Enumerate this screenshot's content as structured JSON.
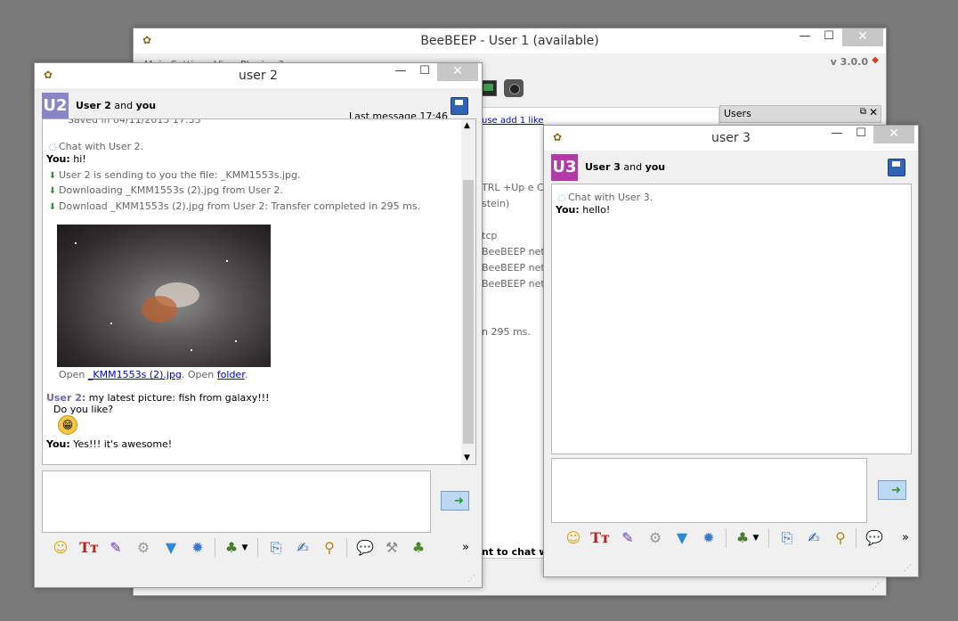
{
  "main_window": {
    "title": "BeeBEEP - User 1 (available)",
    "menu_partial": "Main Settings View Plugins ?",
    "version": "v 3.0.0",
    "users_panel_title": "Users",
    "bg_lines": [
      "TRL +Up e CTF",
      "stein)",
      "tcp",
      "BeeBEEP netv",
      "BeeBEEP netv",
      "BeeBEEP netv",
      "n 295 ms.",
      "nt to chat wi"
    ],
    "bg_link": "use add 1 like"
  },
  "chat_user2": {
    "title": "user 2",
    "badge": "U2",
    "header_user": "User 2",
    "header_and": " and ",
    "header_you": "you",
    "last_message": "Last message 17:46",
    "saved_line": "Saved in 04/11/2015 17:33",
    "messages": {
      "sys_chat": "Chat with User 2.",
      "you_label": "You:",
      "you_msg1": " hi!",
      "file1": "User 2 is sending to you the file: _KMM1553s.jpg.",
      "file2": "Downloading _KMM1553s (2).jpg from User 2.",
      "file3": "Download _KMM1553s (2).jpg from User 2: Transfer completed in 295 ms.",
      "open_text": "Open ",
      "open_file_link": "_KMM1553s (2).jpg",
      "open_mid": ". Open ",
      "open_folder_link": "folder",
      "open_end": ".",
      "user2_label": "User 2:",
      "user2_msg": " my latest picture: fish from galaxy!!!",
      "user2_msg2": "Do you like?",
      "you_label2": "You:",
      "you_msg2": " Yes!!! it's awesome!"
    }
  },
  "chat_user3": {
    "title": "user 3",
    "badge": "U3",
    "header_user": "User 3",
    "header_and": " and ",
    "header_you": "you",
    "messages": {
      "sys_chat": "Chat with User 3.",
      "you_label": "You:",
      "you_msg": " hello!"
    }
  },
  "window_controls": {
    "minimize": "—",
    "maximize": "☐",
    "close": "✕"
  },
  "icons": {
    "app": "bee-icon",
    "send": "send-mail-icon",
    "save": "save-floppy-icon",
    "toolbar": [
      "smiley-icon",
      "font-icon",
      "color-icon",
      "filter-settings-icon",
      "funnel-icon",
      "gear-icon",
      "users-icon",
      "send-file-icon",
      "edit-note-icon",
      "broom-icon",
      "chat-bubbles-icon",
      "tools-icon",
      "add-user-icon"
    ],
    "more": "»"
  },
  "colors": {
    "u2_badge": "#8b85c8",
    "u3_badge": "#b13aa8",
    "user2_name": "#6e6aa8"
  }
}
